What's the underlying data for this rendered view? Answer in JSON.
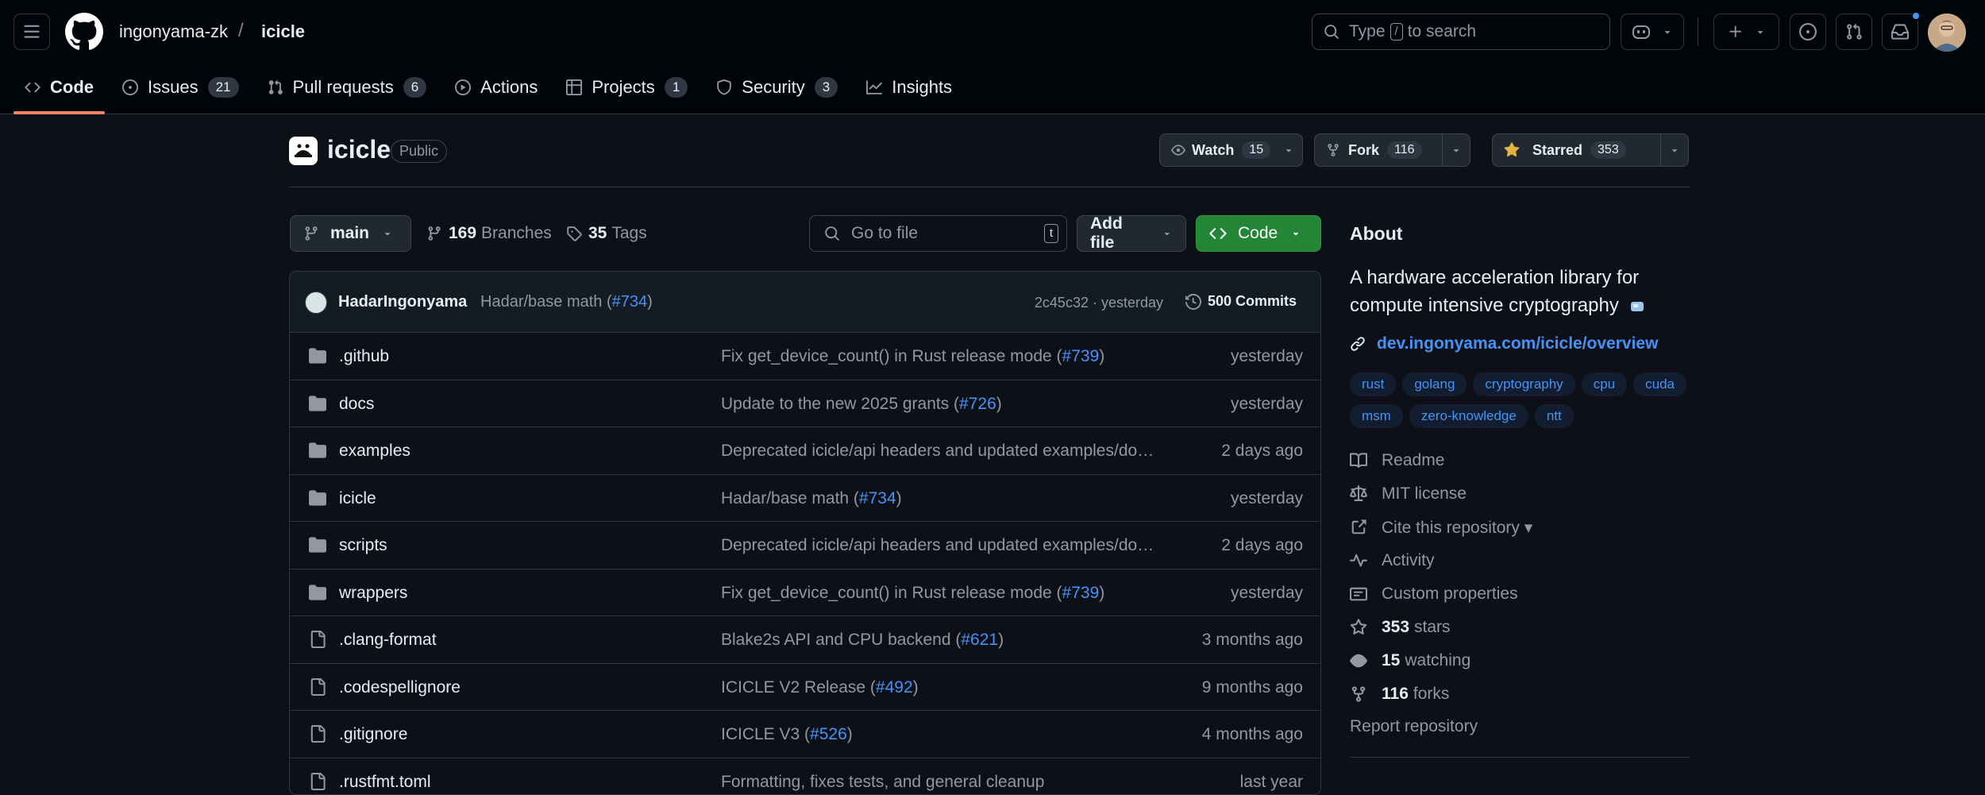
{
  "header": {
    "owner": "ingonyama-zk",
    "separator": "/",
    "repo": "icicle",
    "search": {
      "prefix": "Type",
      "key": "/",
      "suffix": "to search"
    }
  },
  "tabs": [
    {
      "label": "Code",
      "icon": "code-icon",
      "active": true
    },
    {
      "label": "Issues",
      "icon": "issue-opened-icon",
      "count": "21"
    },
    {
      "label": "Pull requests",
      "icon": "git-pull-request-icon",
      "count": "6"
    },
    {
      "label": "Actions",
      "icon": "play-icon"
    },
    {
      "label": "Projects",
      "icon": "table-icon",
      "count": "1"
    },
    {
      "label": "Security",
      "icon": "shield-icon",
      "count": "3"
    },
    {
      "label": "Insights",
      "icon": "graph-icon"
    }
  ],
  "repo": {
    "name": "icicle",
    "visibility": "Public",
    "watch": {
      "label": "Watch",
      "count": "15"
    },
    "fork": {
      "label": "Fork",
      "count": "116"
    },
    "star": {
      "label": "Starred",
      "count": "353"
    }
  },
  "browser": {
    "branch": "main",
    "branches_count": "169",
    "branches_label": "Branches",
    "tags_count": "35",
    "tags_label": "Tags",
    "goto_placeholder": "Go to file",
    "goto_key": "t",
    "add_file": "Add file",
    "code": "Code"
  },
  "commit": {
    "author": "HadarIngonyama",
    "message": "Hadar/base math (",
    "pr": "#734",
    "message_end": ")",
    "sha_time": "2c45c32 · yesterday",
    "commits": "500 Commits"
  },
  "files": [
    {
      "type": "dir",
      "name": ".github",
      "msg": "Fix get_device_count() in Rust release mode (",
      "pr": "#739",
      "end": ")",
      "when": "yesterday"
    },
    {
      "type": "dir",
      "name": "docs",
      "msg": "Update to the new 2025 grants (",
      "pr": "#726",
      "end": ")",
      "when": "yesterday"
    },
    {
      "type": "dir",
      "name": "examples",
      "msg": "Deprecated icicle/api headers and updated examples/doc…",
      "pr": "",
      "end": "",
      "when": "2 days ago"
    },
    {
      "type": "dir",
      "name": "icicle",
      "msg": "Hadar/base math (",
      "pr": "#734",
      "end": ")",
      "when": "yesterday"
    },
    {
      "type": "dir",
      "name": "scripts",
      "msg": "Deprecated icicle/api headers and updated examples/doc…",
      "pr": "",
      "end": "",
      "when": "2 days ago"
    },
    {
      "type": "dir",
      "name": "wrappers",
      "msg": "Fix get_device_count() in Rust release mode (",
      "pr": "#739",
      "end": ")",
      "when": "yesterday"
    },
    {
      "type": "file",
      "name": ".clang-format",
      "msg": "Blake2s API and CPU backend (",
      "pr": "#621",
      "end": ")",
      "when": "3 months ago"
    },
    {
      "type": "file",
      "name": ".codespellignore",
      "msg": "ICICLE V2 Release (",
      "pr": "#492",
      "end": ")",
      "when": "9 months ago"
    },
    {
      "type": "file",
      "name": ".gitignore",
      "msg": "ICICLE V3 (",
      "pr": "#526",
      "end": ")",
      "when": "4 months ago"
    },
    {
      "type": "file",
      "name": ".rustfmt.toml",
      "msg": "Formatting, fixes tests, and general cleanup",
      "pr": "",
      "end": "",
      "when": "last year"
    }
  ],
  "about": {
    "title": "About",
    "description": "A hardware acceleration library for compute intensive cryptography",
    "homepage": "dev.ingonyama.com/icicle/overview",
    "topics": [
      "rust",
      "golang",
      "cryptography",
      "cpu",
      "cuda",
      "msm",
      "zero-knowledge",
      "ntt"
    ],
    "links": [
      {
        "icon": "book-icon",
        "label": "Readme"
      },
      {
        "icon": "law-icon",
        "label": "MIT license"
      },
      {
        "icon": "cite-icon",
        "label": "Cite this repository ▾"
      },
      {
        "icon": "pulse-icon",
        "label": "Activity"
      },
      {
        "icon": "note-icon",
        "label": "Custom properties"
      },
      {
        "icon": "star-icon",
        "bold": "353",
        "label": "stars"
      },
      {
        "icon": "eye-icon",
        "bold": "15",
        "label": "watching"
      },
      {
        "icon": "repo-forked-icon",
        "bold": "116",
        "label": "forks"
      }
    ],
    "report": "Report repository"
  },
  "colors": {
    "accent": "#4493f8",
    "green": "#238636",
    "tab_underline": "#f78166",
    "star": "#e3b341"
  }
}
